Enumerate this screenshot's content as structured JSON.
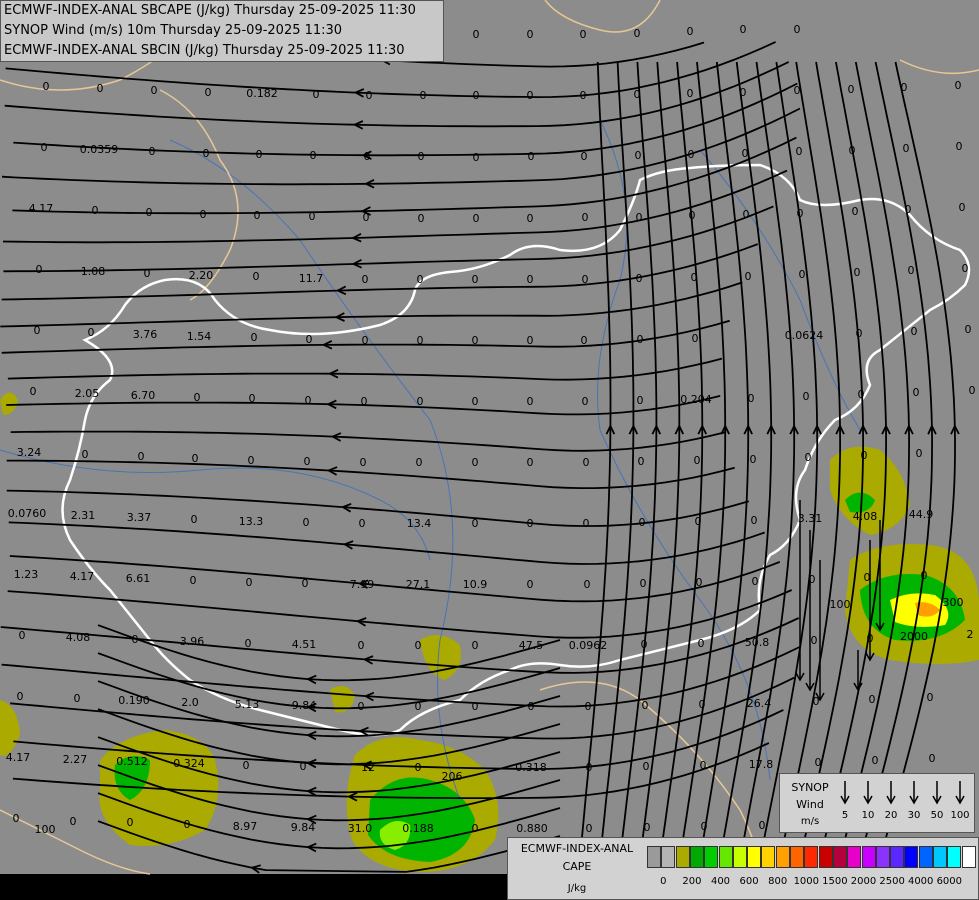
{
  "titles": [
    "ECMWF-INDEX-ANAL SBCAPE (J/kg) Thursday 25-09-2025 11:30",
    "SYNOP Wind (m/s) 10m Thursday 25-09-2025 11:30",
    "ECMWF-INDEX-ANAL SBCIN (J/kg) Thursday 25-09-2025 11:30"
  ],
  "colors": {
    "background": "#8c8c8c",
    "bottom_strip": "#000000",
    "border_white": "#ffffff",
    "border_tan": "#e6c896",
    "rivers": "#4a74b5",
    "cape_olive": "#aaaa00",
    "cape_green": "#00b400"
  },
  "wind_legend": {
    "label_line1": "SYNOP",
    "label_line2": "Wind",
    "label_line3": "m/s",
    "speeds": [
      "5",
      "10",
      "20",
      "30",
      "50",
      "100"
    ],
    "arrow_icon": "down-arrow-icon"
  },
  "cape_legend": {
    "label_line1": "ECMWF-INDEX-ANAL",
    "label_line2": "CAPE",
    "label_line3": "J/kg",
    "colors": [
      "#9a9a9a",
      "#b4b4b4",
      "#aaaa00",
      "#00aa00",
      "#00cc00",
      "#66e600",
      "#c8ff00",
      "#ffff00",
      "#ffd200",
      "#ffa000",
      "#ff6400",
      "#ff2800",
      "#c80000",
      "#b4003c",
      "#e600c8",
      "#c800ff",
      "#8c32ff",
      "#5a28ff",
      "#0000ff",
      "#0064ff",
      "#00c8ff",
      "#00ffff",
      "#ffffff"
    ],
    "ticks": [
      "0",
      "200",
      "400",
      "600",
      "800",
      "1000",
      "1500",
      "2000",
      "2500",
      "4000",
      "6000"
    ]
  },
  "map_labels": [
    [
      "0",
      46,
      90
    ],
    [
      "0",
      100,
      92
    ],
    [
      "0",
      154,
      94
    ],
    [
      "0",
      208,
      96
    ],
    [
      "0.182",
      262,
      97
    ],
    [
      "0",
      316,
      98
    ],
    [
      "0",
      369,
      99
    ],
    [
      "0",
      423,
      99
    ],
    [
      "0",
      476,
      99
    ],
    [
      "0",
      530,
      99
    ],
    [
      "0",
      583,
      99
    ],
    [
      "0",
      637,
      98
    ],
    [
      "0",
      690,
      97
    ],
    [
      "0",
      743,
      96
    ],
    [
      "0",
      797,
      94
    ],
    [
      "0",
      851,
      93
    ],
    [
      "0",
      904,
      91
    ],
    [
      "0",
      958,
      89
    ],
    [
      "0",
      476,
      38
    ],
    [
      "0",
      530,
      38
    ],
    [
      "0",
      583,
      38
    ],
    [
      "0",
      637,
      37
    ],
    [
      "0",
      690,
      35
    ],
    [
      "0",
      743,
      33
    ],
    [
      "0",
      797,
      33
    ],
    [
      "0",
      44,
      151
    ],
    [
      "0.0359",
      99,
      153
    ],
    [
      "0",
      152,
      155
    ],
    [
      "0",
      206,
      157
    ],
    [
      "0",
      259,
      158
    ],
    [
      "0",
      313,
      159
    ],
    [
      "0",
      367,
      160
    ],
    [
      "0",
      421,
      160
    ],
    [
      "0",
      476,
      161
    ],
    [
      "0",
      531,
      160
    ],
    [
      "0",
      584,
      160
    ],
    [
      "0",
      638,
      159
    ],
    [
      "0",
      691,
      158
    ],
    [
      "0",
      745,
      157
    ],
    [
      "0",
      799,
      155
    ],
    [
      "0",
      852,
      154
    ],
    [
      "0",
      906,
      152
    ],
    [
      "0",
      959,
      150
    ],
    [
      "4.17",
      41,
      212
    ],
    [
      "0",
      95,
      214
    ],
    [
      "0",
      149,
      216
    ],
    [
      "0",
      203,
      218
    ],
    [
      "0",
      257,
      219
    ],
    [
      "0",
      312,
      220
    ],
    [
      "0",
      366,
      221
    ],
    [
      "0",
      421,
      222
    ],
    [
      "0",
      476,
      222
    ],
    [
      "0",
      530,
      222
    ],
    [
      "0",
      585,
      221
    ],
    [
      "0",
      639,
      221
    ],
    [
      "0",
      692,
      219
    ],
    [
      "0",
      746,
      218
    ],
    [
      "0",
      800,
      217
    ],
    [
      "0",
      855,
      215
    ],
    [
      "0",
      908,
      213
    ],
    [
      "0",
      962,
      211
    ],
    [
      "0",
      39,
      273
    ],
    [
      "1.08",
      93,
      275
    ],
    [
      "0",
      147,
      277
    ],
    [
      "2.20",
      201,
      279
    ],
    [
      "0",
      256,
      280
    ],
    [
      "11.7",
      311,
      282
    ],
    [
      "0",
      365,
      283
    ],
    [
      "0",
      420,
      283
    ],
    [
      "0",
      475,
      283
    ],
    [
      "0",
      530,
      283
    ],
    [
      "0",
      585,
      283
    ],
    [
      "0",
      639,
      282
    ],
    [
      "0",
      694,
      281
    ],
    [
      "0",
      748,
      280
    ],
    [
      "0",
      802,
      278
    ],
    [
      "0",
      857,
      276
    ],
    [
      "0",
      911,
      274
    ],
    [
      "0",
      965,
      272
    ],
    [
      "0",
      37,
      334
    ],
    [
      "0",
      91,
      336
    ],
    [
      "3.76",
      145,
      338
    ],
    [
      "1.54",
      199,
      340
    ],
    [
      "0",
      254,
      341
    ],
    [
      "0",
      309,
      343
    ],
    [
      "0",
      365,
      344
    ],
    [
      "0",
      420,
      344
    ],
    [
      "0",
      475,
      344
    ],
    [
      "0",
      530,
      344
    ],
    [
      "0",
      584,
      344
    ],
    [
      "0",
      640,
      343
    ],
    [
      "0",
      695,
      342
    ],
    [
      "0.0624",
      804,
      339
    ],
    [
      "0",
      859,
      337
    ],
    [
      "0",
      914,
      335
    ],
    [
      "0",
      968,
      333
    ],
    [
      "0",
      33,
      395
    ],
    [
      "2.05",
      87,
      397
    ],
    [
      "6.70",
      143,
      399
    ],
    [
      "0",
      197,
      401
    ],
    [
      "0",
      252,
      402
    ],
    [
      "0",
      308,
      404
    ],
    [
      "0",
      364,
      405
    ],
    [
      "0",
      420,
      405
    ],
    [
      "0",
      475,
      405
    ],
    [
      "0",
      530,
      405
    ],
    [
      "0",
      585,
      405
    ],
    [
      "0",
      640,
      404
    ],
    [
      "0.204",
      696,
      403
    ],
    [
      "0",
      751,
      402
    ],
    [
      "0",
      806,
      400
    ],
    [
      "0",
      861,
      398
    ],
    [
      "0",
      916,
      396
    ],
    [
      "0",
      972,
      394
    ],
    [
      "3.24",
      29,
      456
    ],
    [
      "0",
      85,
      458
    ],
    [
      "0",
      141,
      460
    ],
    [
      "0",
      195,
      462
    ],
    [
      "0",
      251,
      464
    ],
    [
      "0",
      307,
      465
    ],
    [
      "0",
      363,
      466
    ],
    [
      "0",
      419,
      466
    ],
    [
      "0",
      475,
      466
    ],
    [
      "0",
      530,
      466
    ],
    [
      "0",
      586,
      466
    ],
    [
      "0",
      641,
      465
    ],
    [
      "0",
      697,
      464
    ],
    [
      "0",
      753,
      463
    ],
    [
      "0",
      808,
      461
    ],
    [
      "0",
      864,
      459
    ],
    [
      "0",
      919,
      457
    ],
    [
      "0.0760",
      27,
      517
    ],
    [
      "2.31",
      83,
      519
    ],
    [
      "3.37",
      139,
      521
    ],
    [
      "0",
      194,
      523
    ],
    [
      "13.3",
      251,
      525
    ],
    [
      "0",
      306,
      526
    ],
    [
      "0",
      362,
      527
    ],
    [
      "13.4",
      419,
      527
    ],
    [
      "0",
      475,
      527
    ],
    [
      "0",
      530,
      527
    ],
    [
      "0",
      586,
      527
    ],
    [
      "0",
      642,
      526
    ],
    [
      "0",
      698,
      525
    ],
    [
      "0",
      754,
      524
    ],
    [
      "3.31",
      810,
      522
    ],
    [
      "4.08",
      865,
      520
    ],
    [
      "44.9",
      921,
      518
    ],
    [
      "1.23",
      26,
      578
    ],
    [
      "4.17",
      82,
      580
    ],
    [
      "6.61",
      138,
      582
    ],
    [
      "0",
      193,
      584
    ],
    [
      "0",
      249,
      586
    ],
    [
      "0",
      305,
      587
    ],
    [
      "7.99",
      362,
      588
    ],
    [
      "27.1",
      418,
      588
    ],
    [
      "10.9",
      475,
      588
    ],
    [
      "0",
      530,
      588
    ],
    [
      "0",
      587,
      588
    ],
    [
      "0",
      643,
      587
    ],
    [
      "0",
      699,
      586
    ],
    [
      "0",
      755,
      585
    ],
    [
      "0",
      812,
      583
    ],
    [
      "0",
      867,
      581
    ],
    [
      "0",
      924,
      579
    ],
    [
      "0",
      22,
      639
    ],
    [
      "4.08",
      78,
      641
    ],
    [
      "0",
      135,
      643
    ],
    [
      "3.96",
      192,
      645
    ],
    [
      "0",
      248,
      647
    ],
    [
      "4.51",
      304,
      648
    ],
    [
      "0",
      361,
      649
    ],
    [
      "0",
      418,
      649
    ],
    [
      "0",
      475,
      649
    ],
    [
      "47.5",
      531,
      649
    ],
    [
      "0.0962",
      588,
      649
    ],
    [
      "0",
      644,
      648
    ],
    [
      "0",
      701,
      647
    ],
    [
      "50.8",
      757,
      646
    ],
    [
      "0",
      814,
      644
    ],
    [
      "0",
      870,
      642
    ],
    [
      "2000",
      914,
      640
    ],
    [
      "2",
      970,
      638
    ],
    [
      "0",
      20,
      700
    ],
    [
      "0",
      77,
      702
    ],
    [
      "0.190",
      134,
      704
    ],
    [
      "2.0",
      190,
      706
    ],
    [
      "5.13",
      247,
      708
    ],
    [
      "9.84",
      304,
      709
    ],
    [
      "0",
      361,
      710
    ],
    [
      "0",
      418,
      710
    ],
    [
      "0",
      475,
      710
    ],
    [
      "0",
      531,
      710
    ],
    [
      "0",
      588,
      710
    ],
    [
      "0",
      645,
      709
    ],
    [
      "0",
      702,
      708
    ],
    [
      "26.4",
      759,
      707
    ],
    [
      "0",
      816,
      705
    ],
    [
      "0",
      872,
      703
    ],
    [
      "0",
      930,
      701
    ],
    [
      "4.17",
      18,
      761
    ],
    [
      "2.27",
      75,
      763
    ],
    [
      "0.512",
      132,
      765
    ],
    [
      "0.324",
      189,
      767
    ],
    [
      "0",
      246,
      769
    ],
    [
      "0",
      303,
      770
    ],
    [
      "12",
      368,
      771
    ],
    [
      "0",
      418,
      771
    ],
    [
      "206",
      452,
      780
    ],
    [
      "0.318",
      531,
      771
    ],
    [
      "0",
      589,
      771
    ],
    [
      "0",
      646,
      770
    ],
    [
      "0",
      703,
      769
    ],
    [
      "17.8",
      761,
      768
    ],
    [
      "0",
      818,
      766
    ],
    [
      "0",
      875,
      764
    ],
    [
      "0",
      932,
      762
    ],
    [
      "0",
      16,
      822
    ],
    [
      "100",
      45,
      833
    ],
    [
      "0",
      73,
      825
    ],
    [
      "0",
      130,
      826
    ],
    [
      "0",
      187,
      828
    ],
    [
      "8.97",
      245,
      830
    ],
    [
      "9.84",
      303,
      831
    ],
    [
      "31.0",
      360,
      832
    ],
    [
      "0.188",
      418,
      832
    ],
    [
      "0",
      475,
      832
    ],
    [
      "0.880",
      532,
      832
    ],
    [
      "0",
      589,
      832
    ],
    [
      "0",
      647,
      831
    ],
    [
      "0",
      704,
      830
    ],
    [
      "0",
      762,
      829
    ],
    [
      "0",
      820,
      827
    ],
    [
      "0",
      878,
      825
    ],
    [
      "0",
      935,
      823
    ],
    [
      "100",
      840,
      608
    ],
    [
      "300",
      953,
      606
    ]
  ]
}
